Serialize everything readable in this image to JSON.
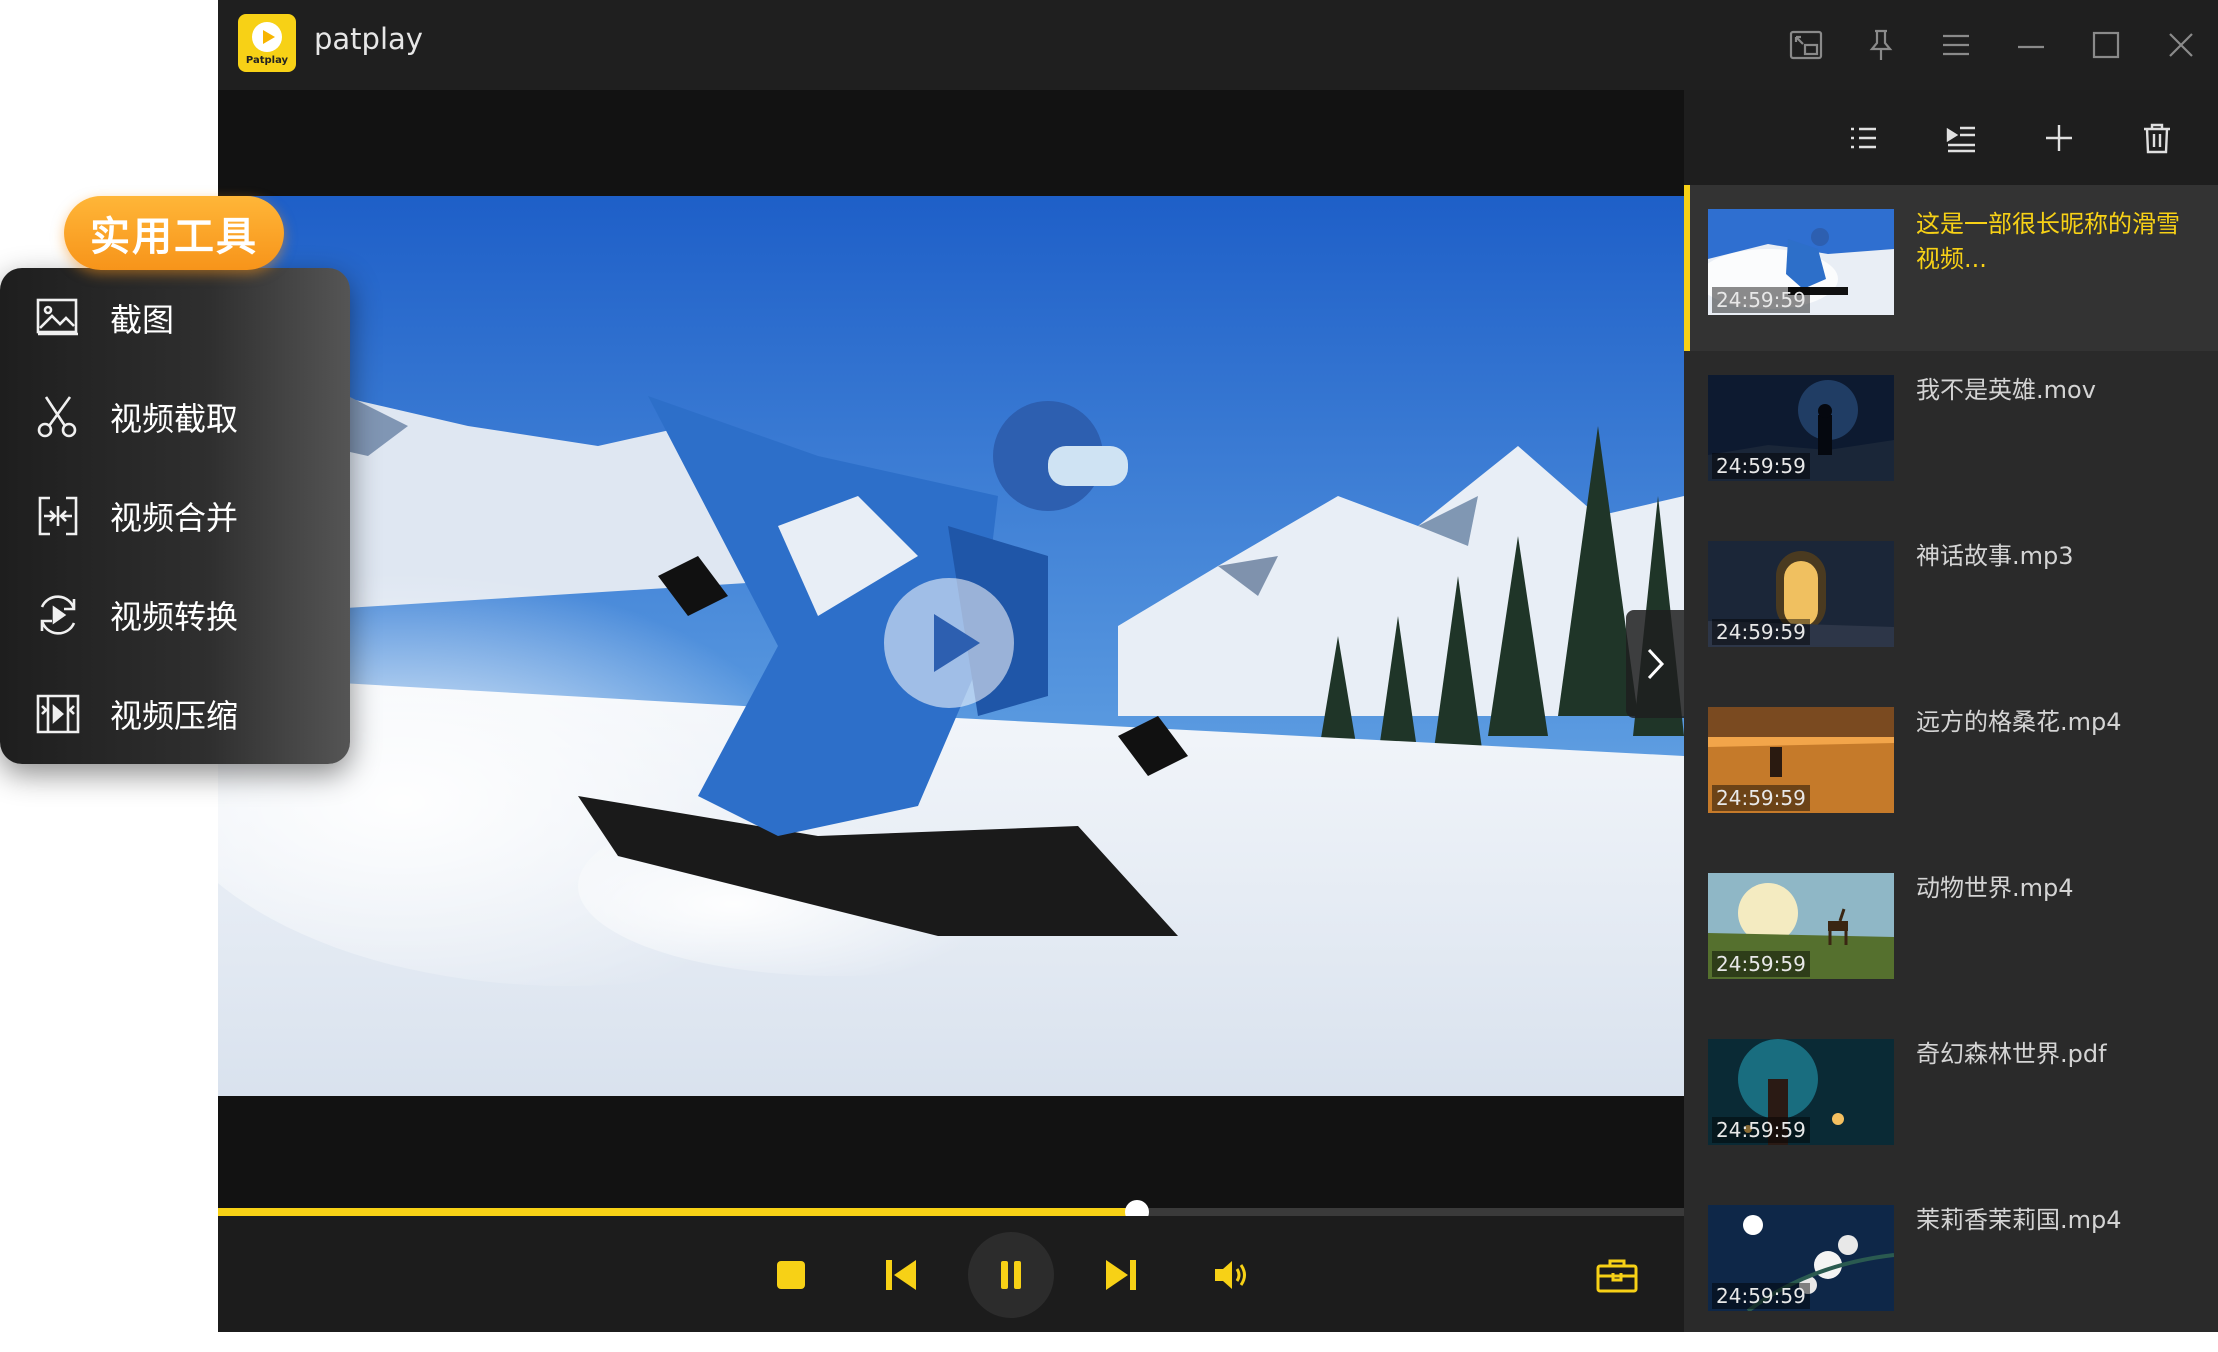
{
  "app": {
    "title": "patplay",
    "logo_text": "Patplay"
  },
  "titlebar": {
    "icons": [
      "picture-in-picture-icon",
      "pin-icon",
      "menu-icon",
      "minimize-icon",
      "maximize-icon",
      "close-icon"
    ]
  },
  "tools": {
    "tag": "实用工具",
    "items": [
      {
        "label": "截图",
        "icon": "screenshot-icon"
      },
      {
        "label": "视频截取",
        "icon": "scissors-icon"
      },
      {
        "label": "视频合并",
        "icon": "merge-icon"
      },
      {
        "label": "视频转换",
        "icon": "convert-icon"
      },
      {
        "label": "视频压缩",
        "icon": "compress-icon"
      }
    ]
  },
  "player": {
    "progress": 0.627,
    "controls": [
      "stop-icon",
      "previous-icon",
      "pause-icon",
      "next-icon",
      "volume-icon",
      "toolbox-icon"
    ]
  },
  "playlist": {
    "toolbar": [
      "list-icon",
      "playlist-mode-icon",
      "add-icon",
      "trash-icon"
    ],
    "items": [
      {
        "title": "这是一部很长昵称的滑雪视频...",
        "duration": "24:59:59",
        "active": true
      },
      {
        "title": "我不是英雄.mov",
        "duration": "24:59:59"
      },
      {
        "title": "神话故事.mp3",
        "duration": "24:59:59"
      },
      {
        "title": "远方的格桑花.mp4",
        "duration": "24:59:59"
      },
      {
        "title": "动物世界.mp4",
        "duration": "24:59:59"
      },
      {
        "title": "奇幻森林世界.pdf",
        "duration": "24:59:59"
      },
      {
        "title": "茉莉香茉莉国.mp4",
        "duration": "24:59:59"
      }
    ]
  },
  "colors": {
    "accent": "#f7d116",
    "tag": "#f7941a",
    "background": "#161616"
  }
}
